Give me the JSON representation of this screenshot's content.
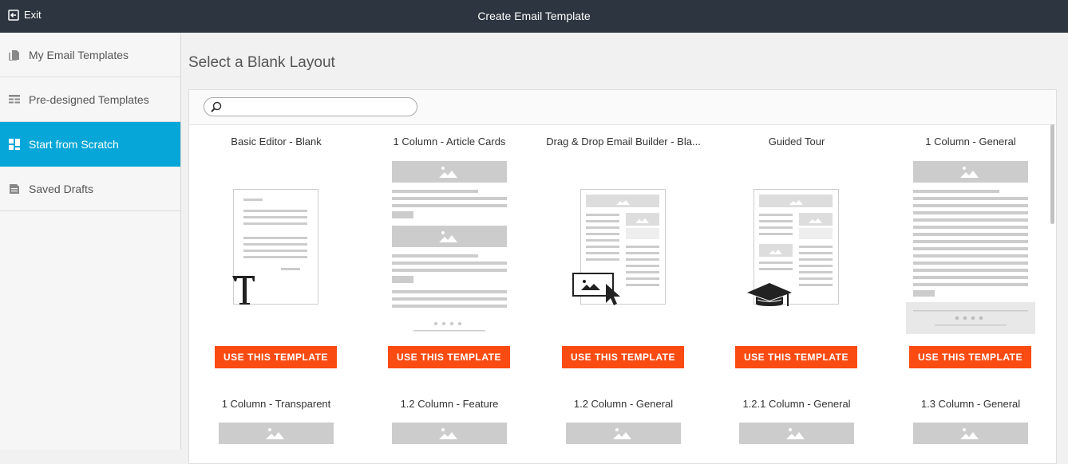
{
  "topbar": {
    "exit_label": "Exit",
    "title": "Create Email Template"
  },
  "sidebar": {
    "items": [
      {
        "label": "My Email Templates",
        "icon": "document-icon"
      },
      {
        "label": "Pre-designed Templates",
        "icon": "layout-list-icon"
      },
      {
        "label": "Start from Scratch",
        "icon": "grid-layout-icon",
        "active": true
      },
      {
        "label": "Saved Drafts",
        "icon": "draft-icon"
      }
    ]
  },
  "main": {
    "heading": "Select a Blank Layout",
    "search": {
      "placeholder": "",
      "value": ""
    },
    "templates": [
      {
        "name": "Basic Editor - Blank",
        "button": "USE THIS TEMPLATE"
      },
      {
        "name": "1 Column - Article Cards",
        "button": "USE THIS TEMPLATE"
      },
      {
        "name": "Drag & Drop Email Builder - Bla...",
        "button": "USE THIS TEMPLATE"
      },
      {
        "name": "Guided Tour",
        "button": "USE THIS TEMPLATE"
      },
      {
        "name": "1 Column - General",
        "button": "USE THIS TEMPLATE"
      },
      {
        "name": "1 Column - Transparent"
      },
      {
        "name": "1.2 Column - Feature"
      },
      {
        "name": "1.2 Column - General"
      },
      {
        "name": "1.2.1 Column - General"
      },
      {
        "name": "1.3 Column - General"
      }
    ]
  },
  "colors": {
    "topbar": "#2d3640",
    "active": "#06a7d8",
    "button": "#fa4c12",
    "placeholder": "#cccccc"
  }
}
